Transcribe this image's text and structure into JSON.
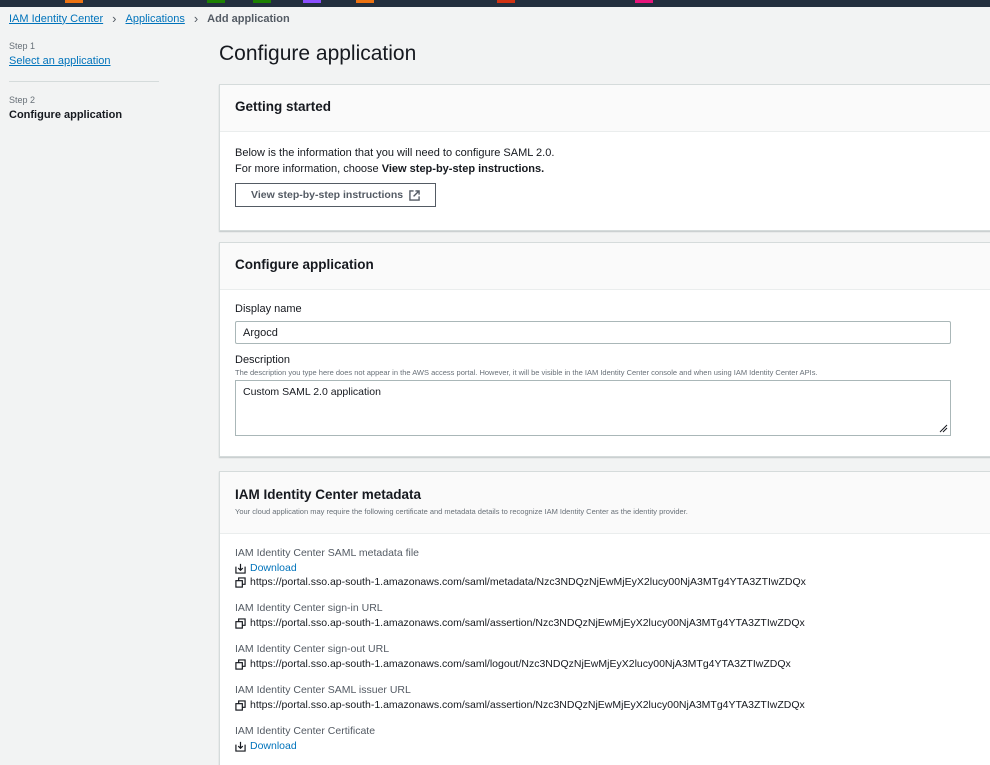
{
  "topbar": {
    "colors": [
      "#ec7211",
      "#1d8102",
      "#1d8102",
      "#8c4fff",
      "#ec7211",
      "#d13212",
      "#e7157b"
    ]
  },
  "breadcrumb": {
    "items": [
      "IAM Identity Center",
      "Applications"
    ],
    "current": "Add application"
  },
  "steps": [
    {
      "label": "Step 1",
      "title": "Select an application"
    },
    {
      "label": "Step 2",
      "title": "Configure application"
    }
  ],
  "page_title": "Configure application",
  "getting_started": {
    "title": "Getting started",
    "line1": "Below is the information that you will need to configure SAML 2.0.",
    "line2_prefix": "For more information, choose ",
    "line2_bold": "View step-by-step instructions.",
    "button": "View step-by-step instructions"
  },
  "configure": {
    "title": "Configure application",
    "display_name_label": "Display name",
    "display_name_value": "Argocd",
    "description_label": "Description",
    "description_hint": "The description you type here does not appear in the AWS access portal. However, it will be visible in the IAM Identity Center console and when using IAM Identity Center APIs.",
    "description_value": "Custom SAML 2.0 application"
  },
  "metadata": {
    "title": "IAM Identity Center metadata",
    "subtitle": "Your cloud application may require the following certificate and metadata details to recognize IAM Identity Center as the identity provider.",
    "download": "Download",
    "metadata_file_label": "IAM Identity Center SAML metadata file",
    "metadata_file_url": "https://portal.sso.ap-south-1.amazonaws.com/saml/metadata/Nzc3NDQzNjEwMjEyX2lucy00NjA3MTg4YTA3ZTIwZDQx",
    "signin_label": "IAM Identity Center sign-in URL",
    "signin_url": "https://portal.sso.ap-south-1.amazonaws.com/saml/assertion/Nzc3NDQzNjEwMjEyX2lucy00NjA3MTg4YTA3ZTIwZDQx",
    "signout_label": "IAM Identity Center sign-out URL",
    "signout_url": "https://portal.sso.ap-south-1.amazonaws.com/saml/logout/Nzc3NDQzNjEwMjEyX2lucy00NjA3MTg4YTA3ZTIwZDQx",
    "issuer_label": "IAM Identity Center SAML issuer URL",
    "issuer_url": "https://portal.sso.ap-south-1.amazonaws.com/saml/assertion/Nzc3NDQzNjEwMjEyX2lucy00NjA3MTg4YTA3ZTIwZDQx",
    "cert_label": "IAM Identity Center Certificate"
  }
}
